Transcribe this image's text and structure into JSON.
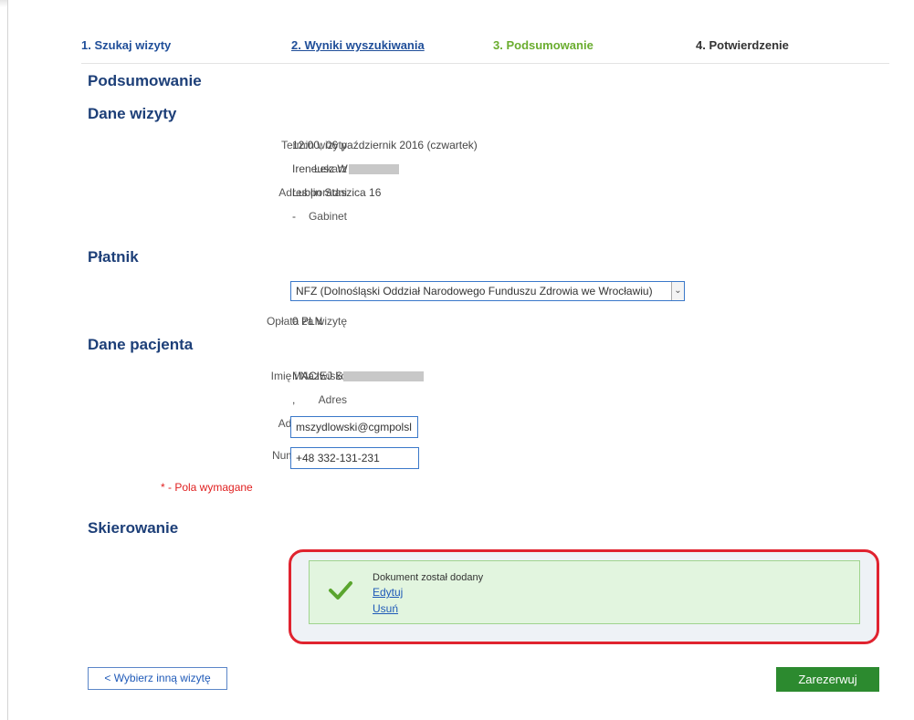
{
  "steps": [
    {
      "label": "1. Szukaj wizyty"
    },
    {
      "label": "2. Wyniki wyszukiwania"
    },
    {
      "label": "3. Podsumowanie"
    },
    {
      "label": "4. Potwierdzenie"
    }
  ],
  "page_title": "Podsumowanie",
  "visit": {
    "heading": "Dane wizyty",
    "term_label": "Termin wizyty",
    "term_value": "12:00, 06 październik 2016 (czwartek)",
    "doctor_label": "Lekarz",
    "doctor_value": "Ireneusz W",
    "address_label": "Adres poradni",
    "address_value": "Lublin Staszica 16",
    "room_label": "Gabinet",
    "room_value": "-"
  },
  "payer": {
    "heading": "Płatnik",
    "payer_label": "Płatnik",
    "payer_value": "NFZ (Dolnośląski Oddział Narodowego Funduszu Zdrowia we Wrocławiu)",
    "fee_label": "Opłata za wizytę",
    "fee_value": "0 PLN"
  },
  "patient": {
    "heading": "Dane pacjenta",
    "name_label": "Imię i Nazwisko",
    "name_value": "MACIEJ S",
    "address_label": "Adres",
    "address_value": ",",
    "email_label": "Adres e-mail",
    "email_star": "*",
    "email_value": "mszydlowski@cgmpolsl",
    "phone_label": "Numer telefonu",
    "phone_value": "+48 332-131-231",
    "required_note": "* - Pola wymagane"
  },
  "referral": {
    "heading": "Skierowanie",
    "message": "Dokument został dodany",
    "edit_link": "Edytuj",
    "delete_link": "Usuń"
  },
  "buttons": {
    "back": "< Wybierz inną wizytę",
    "submit": "Zarezerwuj"
  },
  "colors": {
    "heading": "#1d3f78",
    "active_step": "#6aad2f",
    "submit": "#2c8a2f",
    "highlight_outline": "#e0232f",
    "success_bg": "#e2f5df"
  }
}
